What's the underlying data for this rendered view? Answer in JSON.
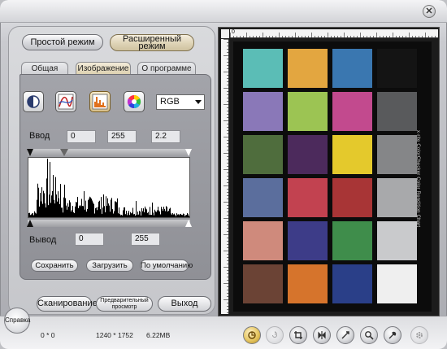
{
  "window": {
    "close_glyph": "✕"
  },
  "modes": {
    "simple": "Простой режим",
    "advanced_line1": "Расширенный",
    "advanced_line2": "режим"
  },
  "tabs": [
    {
      "label": "Общая"
    },
    {
      "label": "Изображение"
    },
    {
      "label": "О программе"
    }
  ],
  "image_tools": {
    "icons": [
      "brightness-contrast-icon",
      "curves-icon",
      "histogram-icon",
      "color-wheel-icon"
    ],
    "channel_select": "RGB"
  },
  "input": {
    "label": "Ввод",
    "black": "0",
    "white": "255",
    "gamma": "2.2"
  },
  "output": {
    "label": "Вывод",
    "black": "0",
    "white": "255"
  },
  "actions": {
    "save": "Сохранить",
    "load": "Загрузить",
    "default": "По умолчанию"
  },
  "main_buttons": {
    "scan": "Сканирование",
    "preview_line1": "Предварительный",
    "preview_line2": "просмотр",
    "exit": "Выход"
  },
  "help": "Справка",
  "status": {
    "coords": "0 * 0",
    "size": "1240 * 1752",
    "filesize": "6.22MB"
  },
  "preview": {
    "ruler_zero": "0",
    "chart_side_text": "x·rite ColorChecker Color Rendition Chart",
    "patch_colors": [
      [
        "#5bbdb6",
        "#e3a640",
        "#3a77b0",
        "#141414"
      ],
      [
        "#8a78b8",
        "#9cc453",
        "#c24a8e",
        "#595a5c"
      ],
      [
        "#4f6d3d",
        "#4c2a5c",
        "#e4c92c",
        "#858688"
      ],
      [
        "#5b6e9d",
        "#c24250",
        "#a83536",
        "#a8a9ab"
      ],
      [
        "#cf8a7c",
        "#3d3c88",
        "#3f8d4b",
        "#c9cacc"
      ],
      [
        "#6b4335",
        "#d6742c",
        "#2a3f88",
        "#efefef"
      ]
    ]
  },
  "toolbar_icons": [
    "scan-settings-icon",
    "rotate-icon",
    "crop-icon",
    "flip-icon",
    "mirror-icon",
    "zoom-icon",
    "adjust-icon",
    "settings-icon"
  ]
}
